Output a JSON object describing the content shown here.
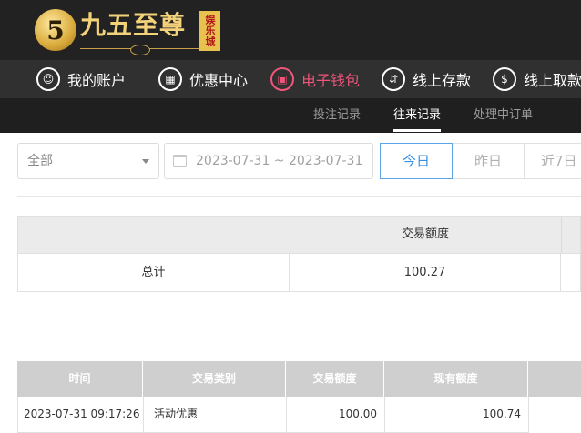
{
  "logo": {
    "mark": "5",
    "name": "九五至尊",
    "badge": "娱乐城"
  },
  "main_nav": [
    {
      "label": "我的账户",
      "icon": "user-icon",
      "glyph": "☺",
      "active": false
    },
    {
      "label": "优惠中心",
      "icon": "gift-icon",
      "glyph": "▦",
      "active": false
    },
    {
      "label": "电子钱包",
      "icon": "wallet-icon",
      "glyph": "▣",
      "active": true
    },
    {
      "label": "线上存款",
      "icon": "deposit-icon",
      "glyph": "⇵",
      "active": false
    },
    {
      "label": "线上取款",
      "icon": "withdraw-icon",
      "glyph": "$",
      "active": false
    }
  ],
  "sub_nav": [
    {
      "label": "投注记录",
      "active": false
    },
    {
      "label": "往来记录",
      "active": true
    },
    {
      "label": "处理中订单",
      "active": false
    }
  ],
  "filters": {
    "type_selected": "全部",
    "date_range": "2023-07-31 ~ 2023-07-31",
    "quick": [
      {
        "label": "今日",
        "active": true
      },
      {
        "label": "昨日",
        "active": false
      },
      {
        "label": "近7日",
        "active": false
      }
    ]
  },
  "summary": {
    "header": "交易额度",
    "label": "总计",
    "value": "100.27"
  },
  "table": {
    "columns": [
      "时间",
      "交易类别",
      "交易额度",
      "现有额度"
    ],
    "rows": [
      [
        "2023-07-31 09:17:26",
        "活动优惠",
        "100.00",
        "100.74"
      ]
    ]
  },
  "colors": {
    "active_nav": "#f0557a",
    "active_quick": "#3a8ee0",
    "header_bg": "#222222"
  }
}
